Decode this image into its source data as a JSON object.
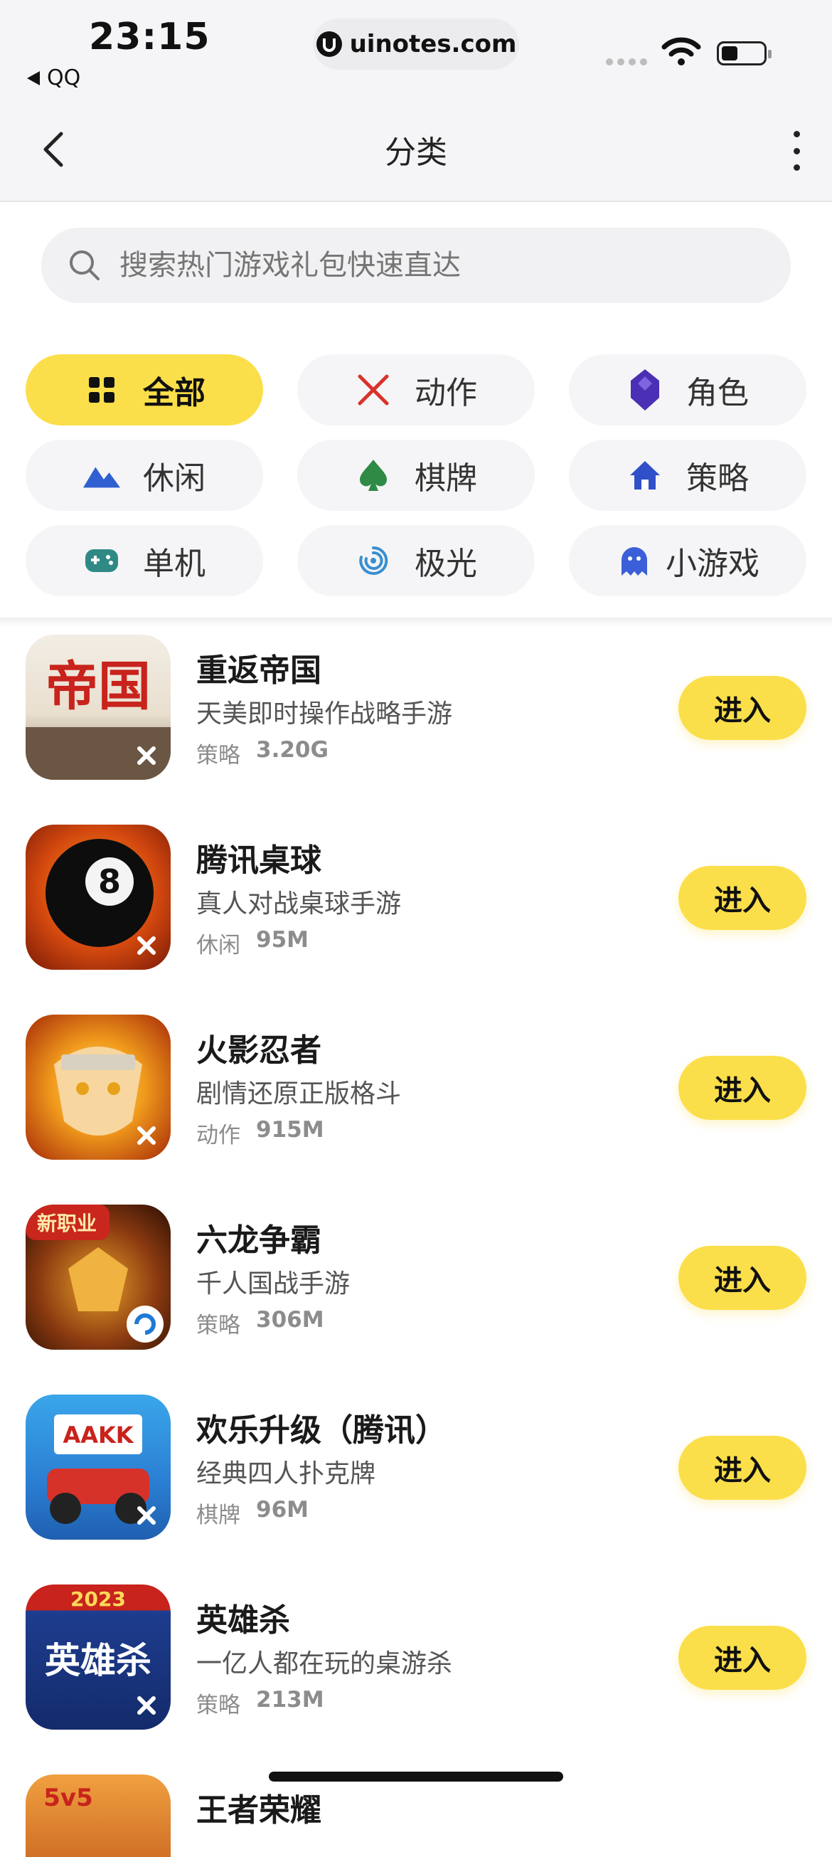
{
  "status_bar": {
    "time": "23:15",
    "back_app": "QQ",
    "url": "uinotes.com"
  },
  "nav": {
    "title": "分类"
  },
  "search": {
    "placeholder": "搜索热门游戏礼包快速直达"
  },
  "categories": [
    {
      "label": "全部",
      "icon": "grid-icon",
      "active": true
    },
    {
      "label": "动作",
      "icon": "crossed-swords-icon",
      "color": "#d9312b"
    },
    {
      "label": "角色",
      "icon": "crystal-icon",
      "color": "#4b2fb5"
    },
    {
      "label": "休闲",
      "icon": "mountain-icon",
      "color": "#2f5fd0"
    },
    {
      "label": "棋牌",
      "icon": "spade-icon",
      "color": "#2f8a45"
    },
    {
      "label": "策略",
      "icon": "house-icon",
      "color": "#2f50c8"
    },
    {
      "label": "单机",
      "icon": "gamepad-icon",
      "color": "#2f8a85"
    },
    {
      "label": "极光",
      "icon": "aurora-icon",
      "color": "#3a8fd0"
    },
    {
      "label": "小游戏",
      "icon": "ghost-icon",
      "color": "#3a5fd8"
    }
  ],
  "games": [
    {
      "name": "重返帝国",
      "desc": "天美即时操作战略手游",
      "category": "策略",
      "size": "3.20G",
      "button": "进入",
      "thumb_text": "帝国"
    },
    {
      "name": "腾讯桌球",
      "desc": "真人对战桌球手游",
      "category": "休闲",
      "size": "95M",
      "button": "进入",
      "thumb_text": "8"
    },
    {
      "name": "火影忍者",
      "desc": "剧情还原正版格斗",
      "category": "动作",
      "size": "915M",
      "button": "进入",
      "thumb_text": ""
    },
    {
      "name": "六龙争霸",
      "desc": "千人国战手游",
      "category": "策略",
      "size": "306M",
      "button": "进入",
      "thumb_text": "新职业"
    },
    {
      "name": "欢乐升级（腾讯）",
      "desc": "经典四人扑克牌",
      "category": "棋牌",
      "size": "96M",
      "button": "进入",
      "thumb_text": "AAKK"
    },
    {
      "name": "英雄杀",
      "desc": "一亿人都在玩的桌游杀",
      "category": "策略",
      "size": "213M",
      "button": "进入",
      "thumb_text": "英雄杀",
      "thumb_badge": "2023"
    }
  ],
  "partial_item": {
    "name": "王者荣耀",
    "thumb_text": "5v5"
  },
  "colors": {
    "accent": "#fbdf4a",
    "background": "#f5f5f7"
  }
}
